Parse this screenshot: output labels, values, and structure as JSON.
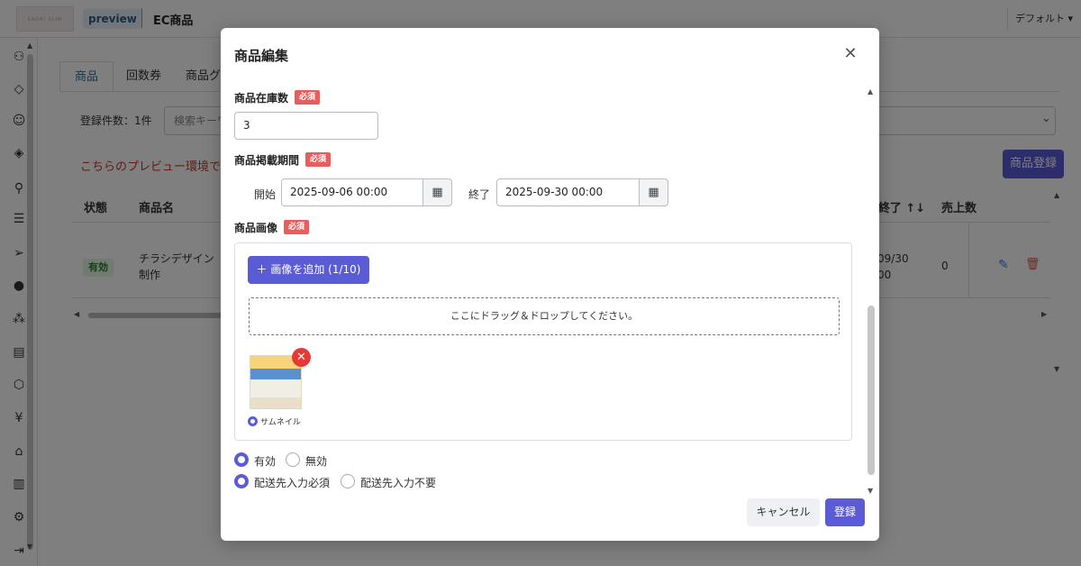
{
  "header": {
    "logo_text": "KAORI SLIM DREAM",
    "preview_badge": "preview",
    "title": "EC商品",
    "default_dropdown": "デフォルト ▾"
  },
  "tabs": [
    "商品",
    "回数券",
    "商品グ"
  ],
  "list": {
    "count_label": "登録件数：1件",
    "search_placeholder": "検索キーワ",
    "preview_warning": "こちらのプレビュー環境では",
    "register_button": "商品登録",
    "columns": [
      "状態",
      "商品名",
      "e終了 ↑↓",
      "売上数"
    ],
    "rows": [
      {
        "status": "有効",
        "name_line1": "チラシデザイン",
        "name_line2": "制作",
        "end_line1": "09/30",
        "end_line2": "00",
        "sales": "0"
      }
    ]
  },
  "modal": {
    "title": "商品編集",
    "required_badge": "必須",
    "stock": {
      "label": "商品在庫数",
      "value": "3"
    },
    "period": {
      "label": "商品掲載期間",
      "start_label": "開始",
      "start_value": "2025-09-06 00:00",
      "end_label": "終了",
      "end_value": "2025-09-30 00:00"
    },
    "image": {
      "label": "商品画像",
      "add_button": "＋ 画像を追加 (1/10)",
      "dropzone_text": "ここにドラッグ＆ドロップしてください。",
      "thumbnail_label": "サムネイル",
      "thumbnail_selected": true
    },
    "status_options": [
      {
        "label": "有効",
        "checked": true
      },
      {
        "label": "無効",
        "checked": false
      }
    ],
    "shipping_options": [
      {
        "label": "配送先入力必須",
        "checked": true
      },
      {
        "label": "配送先入力不要",
        "checked": false
      }
    ],
    "cancel_button": "キャンセル",
    "submit_button": "登録"
  },
  "colors": {
    "accent": "#5b5bd6",
    "required": "#e85d5d",
    "warning_text": "#c0392b",
    "overlay": "rgba(0,0,0,0.5)"
  },
  "icons": {
    "close": "close-icon",
    "calendar": "calendar-icon",
    "remove": "remove-icon",
    "edit": "edit-icon",
    "delete": "trash-icon"
  }
}
